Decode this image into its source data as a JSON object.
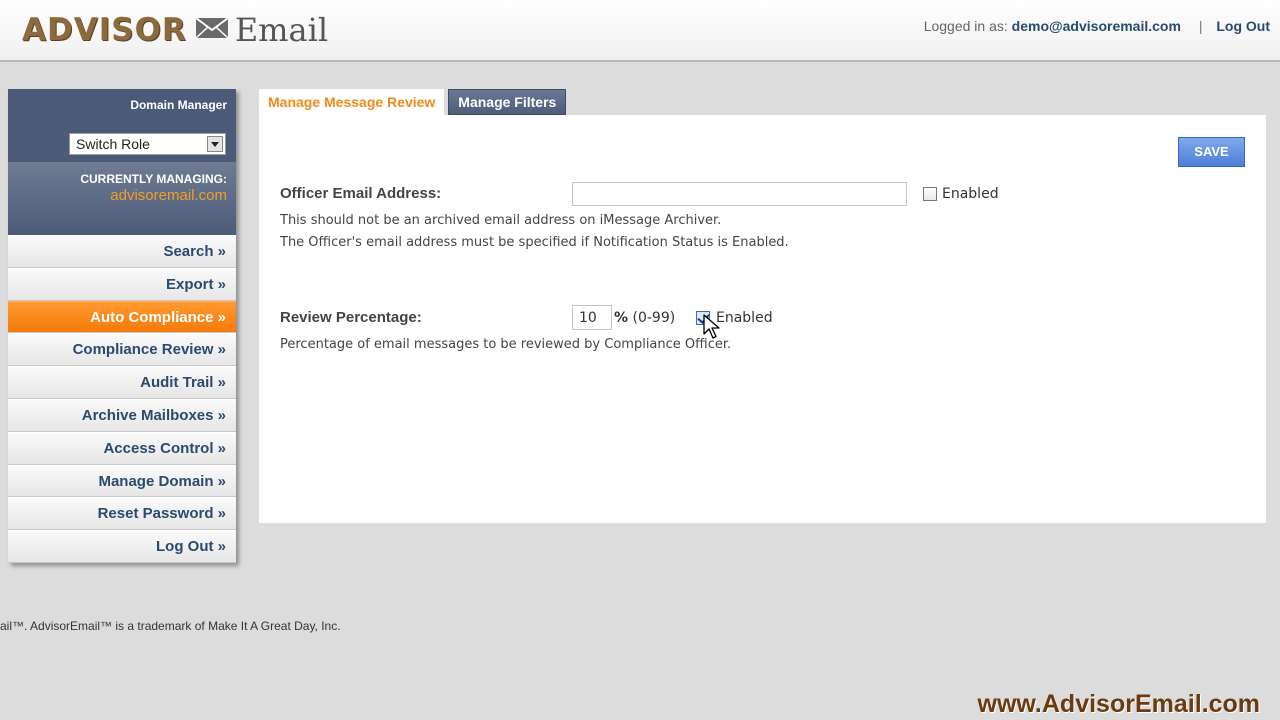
{
  "header": {
    "logo_part1": "ADVISOR",
    "logo_part2": "Email",
    "logged_in_label": "Logged in as:",
    "user_email": "demo@advisoremail.com",
    "separator": "|",
    "logout_label": "Log Out"
  },
  "sidebar": {
    "title": "Domain Manager",
    "switch_role": "Switch Role",
    "managing_label": "CURRENTLY MANAGING:",
    "managing_domain": "advisoremail.com",
    "items": [
      {
        "label": "Search »"
      },
      {
        "label": "Export »"
      },
      {
        "label": "Auto Compliance »"
      },
      {
        "label": "Compliance Review »"
      },
      {
        "label": "Audit Trail »"
      },
      {
        "label": "Archive Mailboxes »"
      },
      {
        "label": "Access Control »"
      },
      {
        "label": "Manage Domain »"
      },
      {
        "label": "Reset Password »"
      },
      {
        "label": "Log Out »"
      }
    ],
    "active_index": 2
  },
  "tabs": {
    "active": "Manage Message Review",
    "inactive": "Manage Filters"
  },
  "form": {
    "save_label": "SAVE",
    "officer_label": "Officer Email Address:",
    "officer_value": "",
    "officer_enabled_label": "Enabled",
    "officer_enabled": false,
    "officer_help1": "This should not be an archived email address on iMessage Archiver.",
    "officer_help2": "The Officer's email address must be specified if Notification Status is Enabled.",
    "review_label": "Review Percentage:",
    "review_value": "10",
    "review_unit": "%",
    "review_range": "(0-99)",
    "review_enabled_label": "Enabled",
    "review_enabled": true,
    "review_help": "Percentage of email messages to be reviewed by Compliance Officer."
  },
  "footer": {
    "note": "ail™.  AdvisorEmail™ is a trademark of Make It A Great Day, Inc."
  },
  "watermark": "www.AdvisorEmail.com",
  "colors": {
    "accent_orange": "#f47a0a",
    "nav_blue": "#2b4a70",
    "sidebar_header": "#4a5a78",
    "save_blue": "#4f80d8"
  }
}
